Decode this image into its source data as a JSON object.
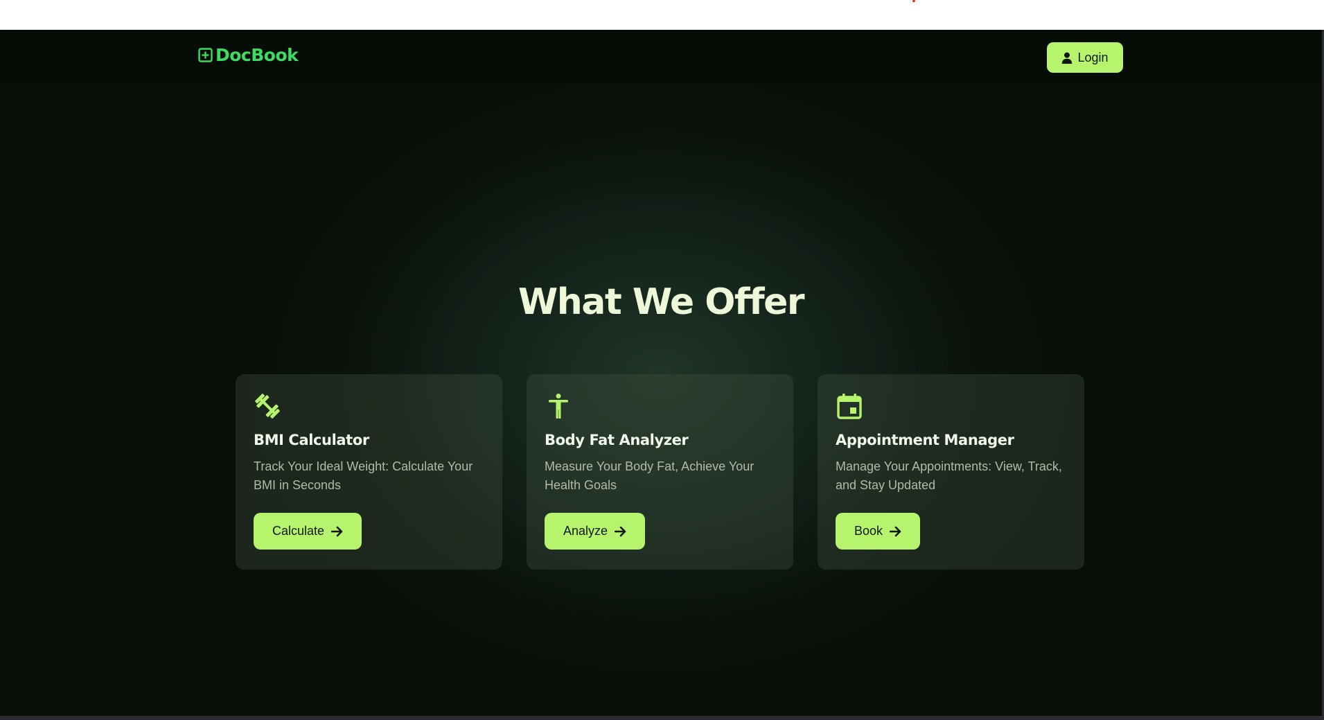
{
  "brand": {
    "name": "DocBook",
    "icon": "medical-plus-icon",
    "color": "#3ddc61"
  },
  "nav": {
    "login_label": "Login",
    "login_icon": "user-icon"
  },
  "hero": {
    "title": "What We Offer"
  },
  "cards": [
    {
      "icon": "dumbbell-icon",
      "title": "BMI Calculator",
      "description": "Track Your Ideal Weight: Calculate Your BMI in Seconds",
      "button_label": "Calculate"
    },
    {
      "icon": "accessibility-person-icon",
      "title": "Body Fat Analyzer",
      "description": "Measure Your Body Fat, Achieve Your Health Goals",
      "button_label": "Analyze"
    },
    {
      "icon": "calendar-event-icon",
      "title": "Appointment Manager",
      "description": "Manage Your Appointments: View, Track, and Stay Updated",
      "button_label": "Book"
    }
  ],
  "colors": {
    "accent": "#b6f46d",
    "background": "#0b110b",
    "heading": "#eef7d8"
  }
}
